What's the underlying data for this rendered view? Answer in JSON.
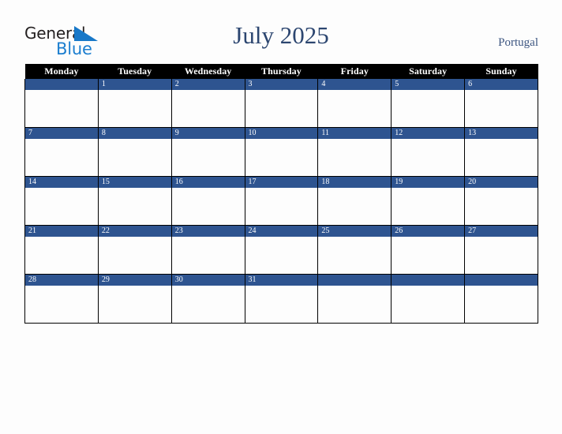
{
  "brand": {
    "name_part1": "General",
    "name_part2": "Blue",
    "triangle_icon": "blue-triangle-icon",
    "color_dark": "#231f20",
    "color_blue": "#1c7ecf"
  },
  "header": {
    "title": "July 2025",
    "locale": "Portugal",
    "title_color": "#2c4670",
    "locale_color": "#3c5580"
  },
  "calendar": {
    "weekday_headers": [
      "Monday",
      "Tuesday",
      "Wednesday",
      "Thursday",
      "Friday",
      "Saturday",
      "Sunday"
    ],
    "header_bg": "#000000",
    "header_text": "#ffffff",
    "daynum_bg": "#2e5490",
    "daynum_text": "#ffffff",
    "cell_bg": "#fdfdfd",
    "grid_line": "#000000",
    "weeks": [
      [
        "",
        "1",
        "2",
        "3",
        "4",
        "5",
        "6"
      ],
      [
        "7",
        "8",
        "9",
        "10",
        "11",
        "12",
        "13"
      ],
      [
        "14",
        "15",
        "16",
        "17",
        "18",
        "19",
        "20"
      ],
      [
        "21",
        "22",
        "23",
        "24",
        "25",
        "26",
        "27"
      ],
      [
        "28",
        "29",
        "30",
        "31",
        "",
        "",
        ""
      ]
    ]
  }
}
